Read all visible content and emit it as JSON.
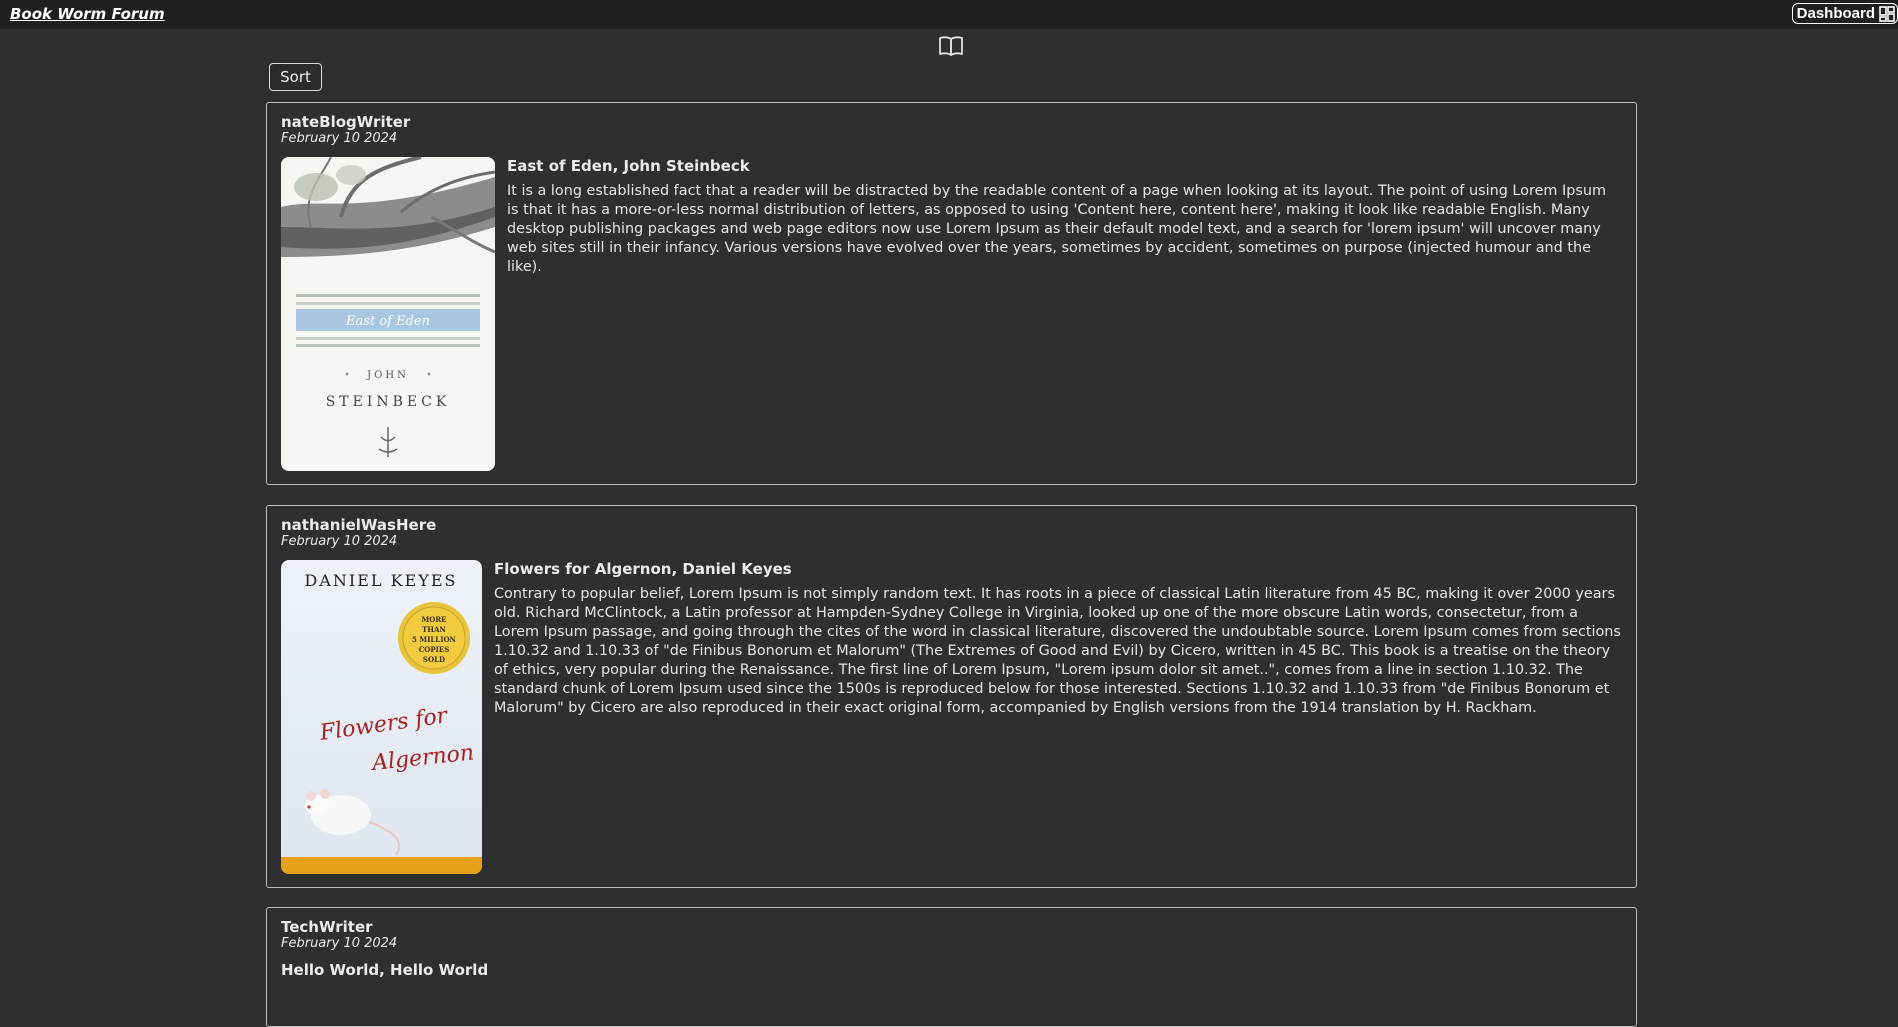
{
  "header": {
    "brand": "Book Worm Forum",
    "dashboard_label": "Dashboard"
  },
  "toolbar": {
    "sort_label": "Sort"
  },
  "posts": [
    {
      "author": "nateBlogWriter",
      "date": "February 10 2024",
      "title": "East of Eden, John Steinbeck",
      "body": "It is a long established fact that a reader will be distracted by the readable content of a page when looking at its layout. The point of using Lorem Ipsum is that it has a more-or-less normal distribution of letters, as opposed to using 'Content here, content here', making it look like readable English. Many desktop publishing packages and web page editors now use Lorem Ipsum as their default model text, and a search for 'lorem ipsum' will uncover many web sites still in their infancy. Various versions have evolved over the years, sometimes by accident, sometimes on purpose (injected humour and the like).",
      "cover": {
        "band_text": "East of Eden",
        "author_first": "JOHN",
        "author_last": "STEINBECK"
      }
    },
    {
      "author": "nathanielWasHere",
      "date": "February 10 2024",
      "title": "Flowers for Algernon, Daniel Keyes",
      "body": "Contrary to popular belief, Lorem Ipsum is not simply random text. It has roots in a piece of classical Latin literature from 45 BC, making it over 2000 years old. Richard McClintock, a Latin professor at Hampden-Sydney College in Virginia, looked up one of the more obscure Latin words, consectetur, from a Lorem Ipsum passage, and going through the cites of the word in classical literature, discovered the undoubtable source. Lorem Ipsum comes from sections 1.10.32 and 1.10.33 of \"de Finibus Bonorum et Malorum\" (The Extremes of Good and Evil) by Cicero, written in 45 BC. This book is a treatise on the theory of ethics, very popular during the Renaissance. The first line of Lorem Ipsum, \"Lorem ipsum dolor sit amet..\", comes from a line in section 1.10.32. The standard chunk of Lorem Ipsum used since the 1500s is reproduced below for those interested. Sections 1.10.32 and 1.10.33 from \"de Finibus Bonorum et Malorum\" by Cicero are also reproduced in their exact original form, accompanied by English versions from the 1914 translation by H. Rackham.",
      "cover": {
        "author_name": "DANIEL KEYES",
        "seal_text": [
          "MORE",
          "THAN",
          "5 MILLION",
          "COPIES",
          "SOLD"
        ],
        "title_line1": "Flowers for",
        "title_line2": "Algernon"
      }
    },
    {
      "author": "TechWriter",
      "date": "February 10 2024",
      "title": "Hello World, Hello World"
    }
  ]
}
